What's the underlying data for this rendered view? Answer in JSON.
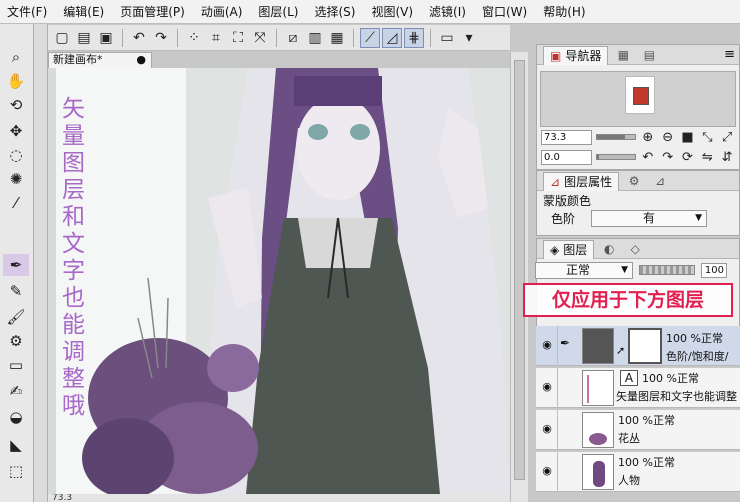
{
  "menu": [
    "文件(F)",
    "编辑(E)",
    "页面管理(P)",
    "动画(A)",
    "图层(L)",
    "选择(S)",
    "视图(V)",
    "滤镜(I)",
    "窗口(W)",
    "帮助(H)"
  ],
  "document_tab": {
    "title": "新建画布*",
    "close": "●"
  },
  "canvas_text": "矢量图层和文字也能调整哦",
  "status_left": "73.3",
  "panels": {
    "navigator": {
      "tab_label": "导航器",
      "zoom_value": "73.3",
      "rotate_value": "0.0"
    },
    "layer_properties": {
      "tab_label": "图层属性",
      "section": "蒙版颜色",
      "field_label": "色阶",
      "field_value": "有"
    },
    "layers": {
      "tab_label": "图层",
      "blend_mode": "正常",
      "opacity": "100"
    }
  },
  "annotation": "仅应用于下方图层",
  "layers": [
    {
      "line1": "100 %正常",
      "line2": "色阶/饱和度/",
      "selected": true
    },
    {
      "line1": "100 %正常",
      "line2": "矢量图层和文字也能调整"
    },
    {
      "line1": "100 %正常",
      "line2": "花丛"
    },
    {
      "line1": "100 %正常",
      "line2": "人物"
    }
  ],
  "icons": {
    "eye": "eye-icon",
    "clip": "clipping-icon",
    "text": "text-layer-icon"
  },
  "colors": {
    "canvas_text": "#a868c8",
    "annotation": "#e02050",
    "selected_layer": "#cfd9ea"
  }
}
